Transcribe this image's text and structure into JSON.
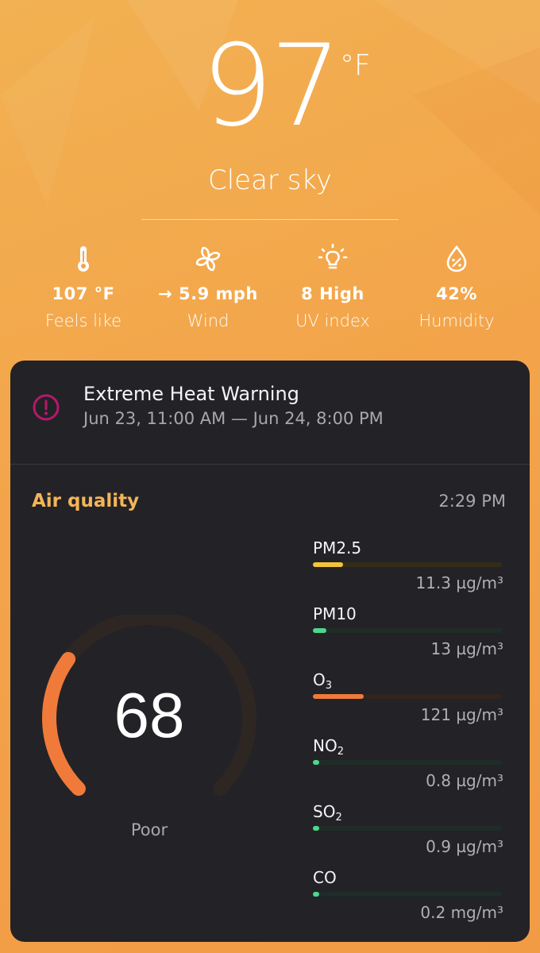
{
  "weather": {
    "temperature": "97",
    "unit": "°F",
    "condition": "Clear sky"
  },
  "stats": [
    {
      "icon": "thermometer-icon",
      "value": "107 °F",
      "label": "Feels like"
    },
    {
      "icon": "fan-icon",
      "value": "→ 5.9 mph",
      "label": "Wind"
    },
    {
      "icon": "lightbulb-icon",
      "value": "8 High",
      "label": "UV index"
    },
    {
      "icon": "humidity-drop-icon",
      "value": "42%",
      "label": "Humidity"
    }
  ],
  "alert": {
    "icon": "alert-circle-icon",
    "title": "Extreme Heat Warning",
    "range": "Jun 23, 11:00 AM — Jun 24, 8:00 PM"
  },
  "air_quality": {
    "title": "Air quality",
    "time": "2:29 PM",
    "aqi": "68",
    "aqi_fraction": 0.3,
    "aqi_color": "#f07a3a",
    "level": "Poor",
    "pollutants": [
      {
        "name": "PM2.5",
        "main": "PM2.5",
        "sub": "",
        "value": "11.3 µg/m³",
        "fraction": 0.16,
        "color": "#f2c43c",
        "track": "#332c19"
      },
      {
        "name": "PM10",
        "main": "PM10",
        "sub": "",
        "value": "13 µg/m³",
        "fraction": 0.07,
        "color": "#4fd68e",
        "track": "#1f2c27"
      },
      {
        "name": "O3",
        "main": "O",
        "sub": "3",
        "value": "121 µg/m³",
        "fraction": 0.27,
        "color": "#f07a3a",
        "track": "#33241d"
      },
      {
        "name": "NO2",
        "main": "NO",
        "sub": "2",
        "value": "0.8 µg/m³",
        "fraction": 0.02,
        "color": "#4fd68e",
        "track": "#1f2c27"
      },
      {
        "name": "SO2",
        "main": "SO",
        "sub": "2",
        "value": "0.9 µg/m³",
        "fraction": 0.02,
        "color": "#4fd68e",
        "track": "#1f2c27"
      },
      {
        "name": "CO",
        "main": "CO",
        "sub": "",
        "value": "0.2 mg/m³",
        "fraction": 0.02,
        "color": "#4fd68e",
        "track": "#1f2c27"
      }
    ]
  }
}
